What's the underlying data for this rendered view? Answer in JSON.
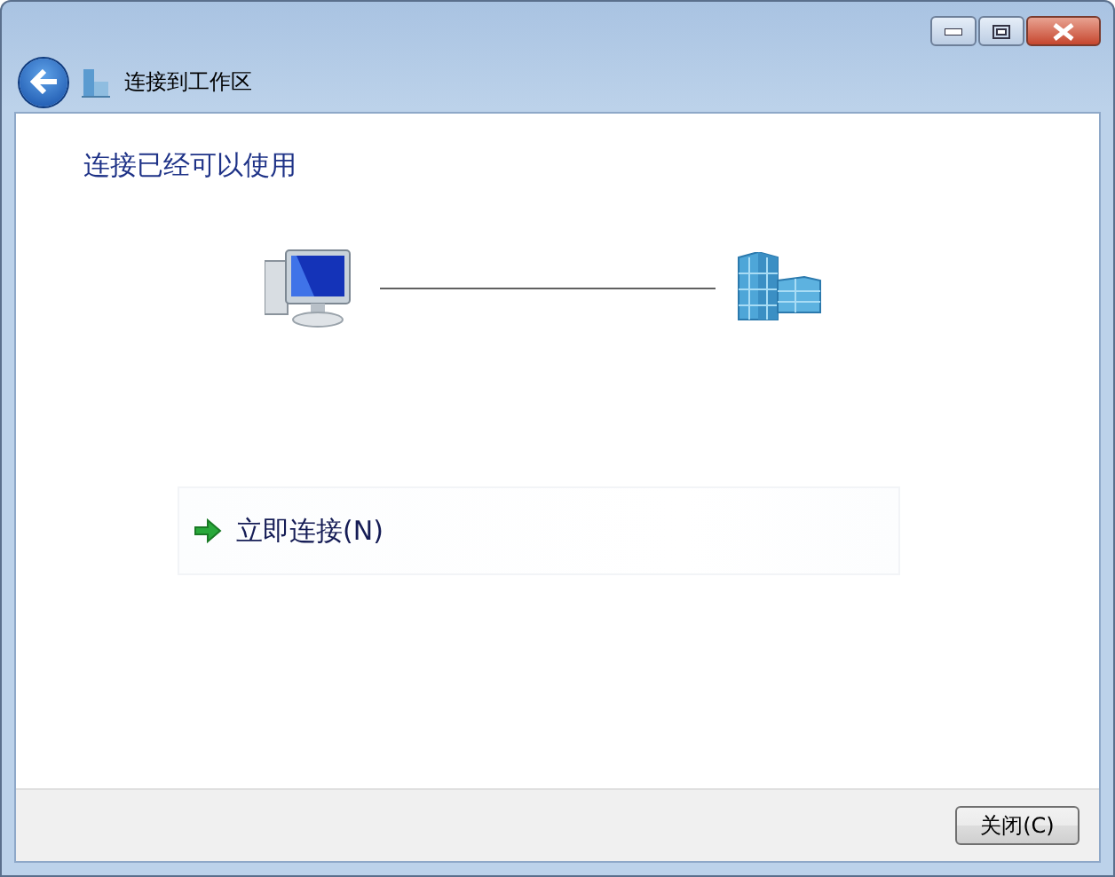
{
  "window": {
    "title": "连接到工作区"
  },
  "heading": "连接已经可以使用",
  "command_link": {
    "label": "立即连接(N)"
  },
  "buttons": [
    "关闭(C)"
  ]
}
